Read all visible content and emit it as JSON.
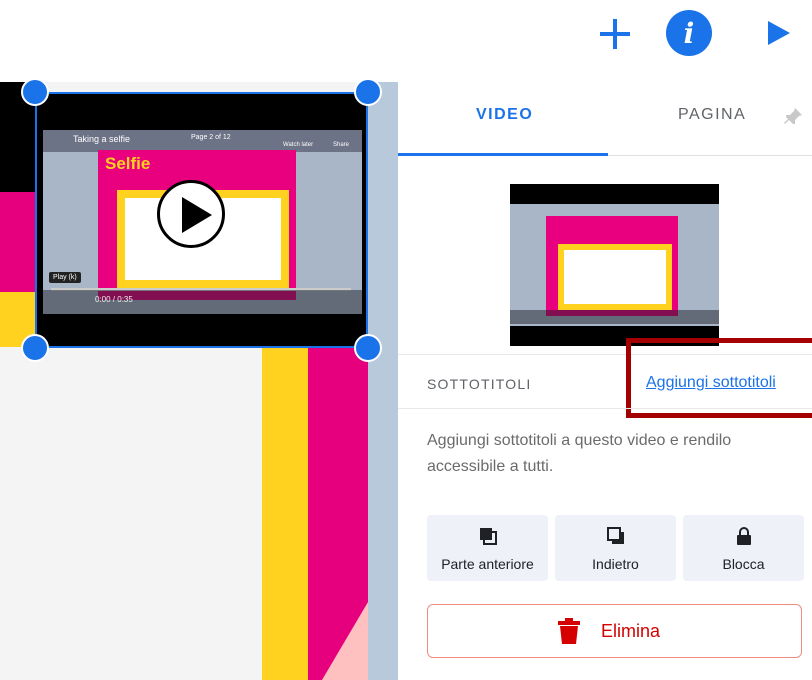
{
  "toolbar": {
    "add_icon": "plus-icon",
    "info_icon": "info-icon",
    "info_glyph": "i",
    "preview_icon": "play-icon"
  },
  "canvas": {
    "video_thumbnail": {
      "title": "Taking a selfie",
      "page_label": "Page 2 of 12",
      "heading": "Selfie",
      "play_label": "Play (k)",
      "time": "0:00 / 0:35",
      "watch_later": "Watch later",
      "share": "Share"
    }
  },
  "panel": {
    "tabs": [
      {
        "label": "VIDEO",
        "active": true
      },
      {
        "label": "PAGINA",
        "active": false
      }
    ],
    "pin_icon": "pin-icon",
    "subtitles": {
      "label": "SOTTOTITOLI",
      "add_link": "Aggiungi sottotitoli",
      "description": "Aggiungi sottotitoli a questo video e rendilo accessibile a tutti."
    },
    "order_buttons": [
      {
        "label": "Parte anteriore",
        "icon": "bring-front-icon"
      },
      {
        "label": "Indietro",
        "icon": "send-back-icon"
      },
      {
        "label": "Blocca",
        "icon": "lock-icon"
      }
    ],
    "delete": {
      "label": "Elimina",
      "icon": "trash-icon"
    }
  },
  "colors": {
    "accent": "#1a73e8",
    "danger": "#d50000",
    "highlight_border": "#a40000"
  }
}
